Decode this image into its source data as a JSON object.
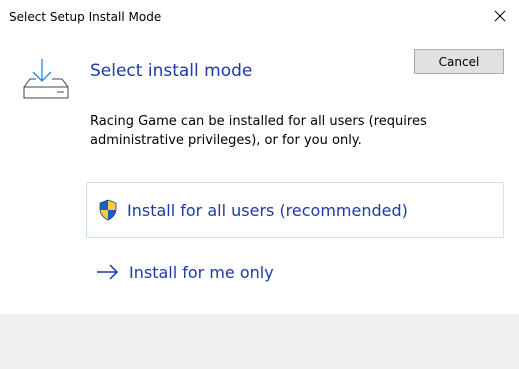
{
  "window": {
    "title": "Select Setup Install Mode",
    "close_icon": "close-icon"
  },
  "header": {
    "icon": "download-tray-icon",
    "heading": "Select install mode",
    "description": "Racing Game can be installed for all users (requires administrative privileges), or for you only."
  },
  "options": {
    "all_users": {
      "icon": "uac-shield-icon",
      "label": "Install for all users (recommended)"
    },
    "me_only": {
      "icon": "arrow-right-icon",
      "label": "Install for me only"
    }
  },
  "footer": {
    "cancel_label": "Cancel"
  },
  "colors": {
    "link": "#1c3aa9",
    "accent": "#0078d7",
    "footer_bg": "#f0f0f0",
    "option_border": "#cce4f7"
  }
}
